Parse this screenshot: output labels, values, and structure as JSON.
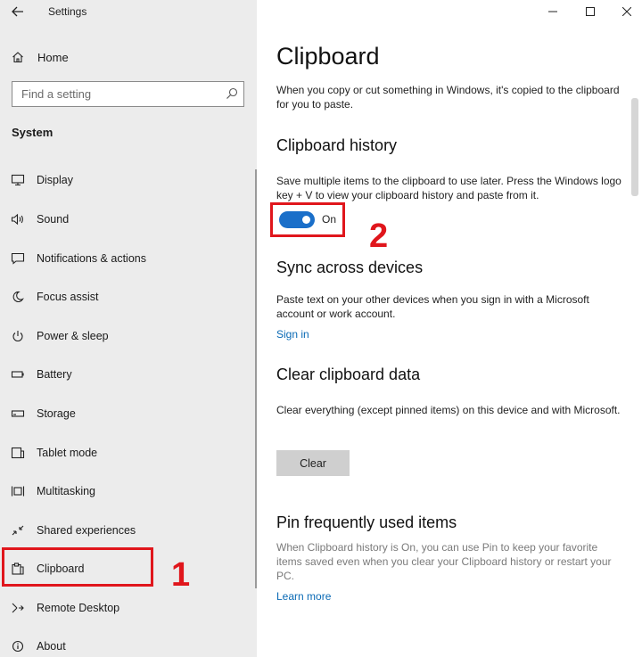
{
  "window": {
    "title": "Settings",
    "controls": {
      "minimize": "minimize-icon",
      "maximize": "maximize-icon",
      "close": "close-icon"
    }
  },
  "sidebar": {
    "home_label": "Home",
    "search": {
      "placeholder": "Find a setting",
      "value": ""
    },
    "section_heading": "System",
    "items": [
      {
        "label": "Display",
        "icon": "display-icon"
      },
      {
        "label": "Sound",
        "icon": "speaker-icon"
      },
      {
        "label": "Notifications & actions",
        "icon": "notification-icon"
      },
      {
        "label": "Focus assist",
        "icon": "moon-icon"
      },
      {
        "label": "Power & sleep",
        "icon": "power-icon"
      },
      {
        "label": "Battery",
        "icon": "battery-icon"
      },
      {
        "label": "Storage",
        "icon": "storage-icon"
      },
      {
        "label": "Tablet mode",
        "icon": "tablet-icon"
      },
      {
        "label": "Multitasking",
        "icon": "multitasking-icon"
      },
      {
        "label": "Shared experiences",
        "icon": "shared-experiences-icon"
      },
      {
        "label": "Clipboard",
        "icon": "clipboard-icon",
        "selected": true
      },
      {
        "label": "Remote Desktop",
        "icon": "remote-desktop-icon"
      },
      {
        "label": "About",
        "icon": "info-icon"
      }
    ]
  },
  "main": {
    "title": "Clipboard",
    "intro": "When you copy or cut something in Windows, it's copied to the clipboard for you to paste.",
    "history": {
      "heading": "Clipboard history",
      "description": "Save multiple items to the clipboard to use later. Press the Windows logo key + V to view your clipboard history and paste from it.",
      "toggle_state": "On",
      "toggle_on": true
    },
    "sync": {
      "heading": "Sync across devices",
      "description": "Paste text on your other devices when you sign in with a Microsoft account or work account.",
      "link": "Sign in"
    },
    "clear": {
      "heading": "Clear clipboard data",
      "description": "Clear everything (except pinned items) on this device and with Microsoft.",
      "button": "Clear"
    },
    "pin": {
      "heading": "Pin frequently used items",
      "description": "When Clipboard history is On, you can use Pin to keep your favorite items saved even when you clear your Clipboard history or restart your PC.",
      "link": "Learn more"
    }
  },
  "annotations": {
    "step1": "1",
    "step2": "2",
    "color": "#e0161c"
  },
  "colors": {
    "sidebar_bg": "#ececec",
    "accent": "#1a6fc9",
    "link": "#0a6ab5"
  }
}
